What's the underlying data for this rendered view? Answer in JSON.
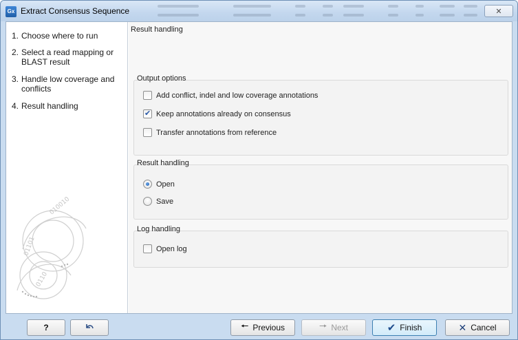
{
  "window": {
    "title": "Extract Consensus Sequence",
    "app_icon_text": "Gx"
  },
  "steps": [
    {
      "num": "1.",
      "label": "Choose where to run"
    },
    {
      "num": "2.",
      "label": "Select a read mapping or BLAST result"
    },
    {
      "num": "3.",
      "label": "Handle low coverage and conflicts"
    },
    {
      "num": "4.",
      "label": "Result handling"
    }
  ],
  "panel": {
    "heading": "Result handling",
    "output_options": {
      "title": "Output options",
      "items": [
        {
          "label": "Add conflict, indel and low coverage annotations",
          "checked": false
        },
        {
          "label": "Keep annotations already on consensus",
          "checked": true
        },
        {
          "label": "Transfer annotations from reference",
          "checked": false
        }
      ]
    },
    "result_handling": {
      "title": "Result handling",
      "options": [
        {
          "label": "Open",
          "selected": true
        },
        {
          "label": "Save",
          "selected": false
        }
      ]
    },
    "log_handling": {
      "title": "Log handling",
      "items": [
        {
          "label": "Open log",
          "checked": false
        }
      ]
    }
  },
  "footer": {
    "help_label": "?",
    "reset_icon": "undo-arrow-icon",
    "previous_label": "Previous",
    "next_label": "Next",
    "finish_label": "Finish",
    "cancel_label": "Cancel"
  },
  "colors": {
    "frame": "#c9dcf0",
    "panel_bg": "#f7f7f7",
    "accent": "#2a5aa8"
  }
}
